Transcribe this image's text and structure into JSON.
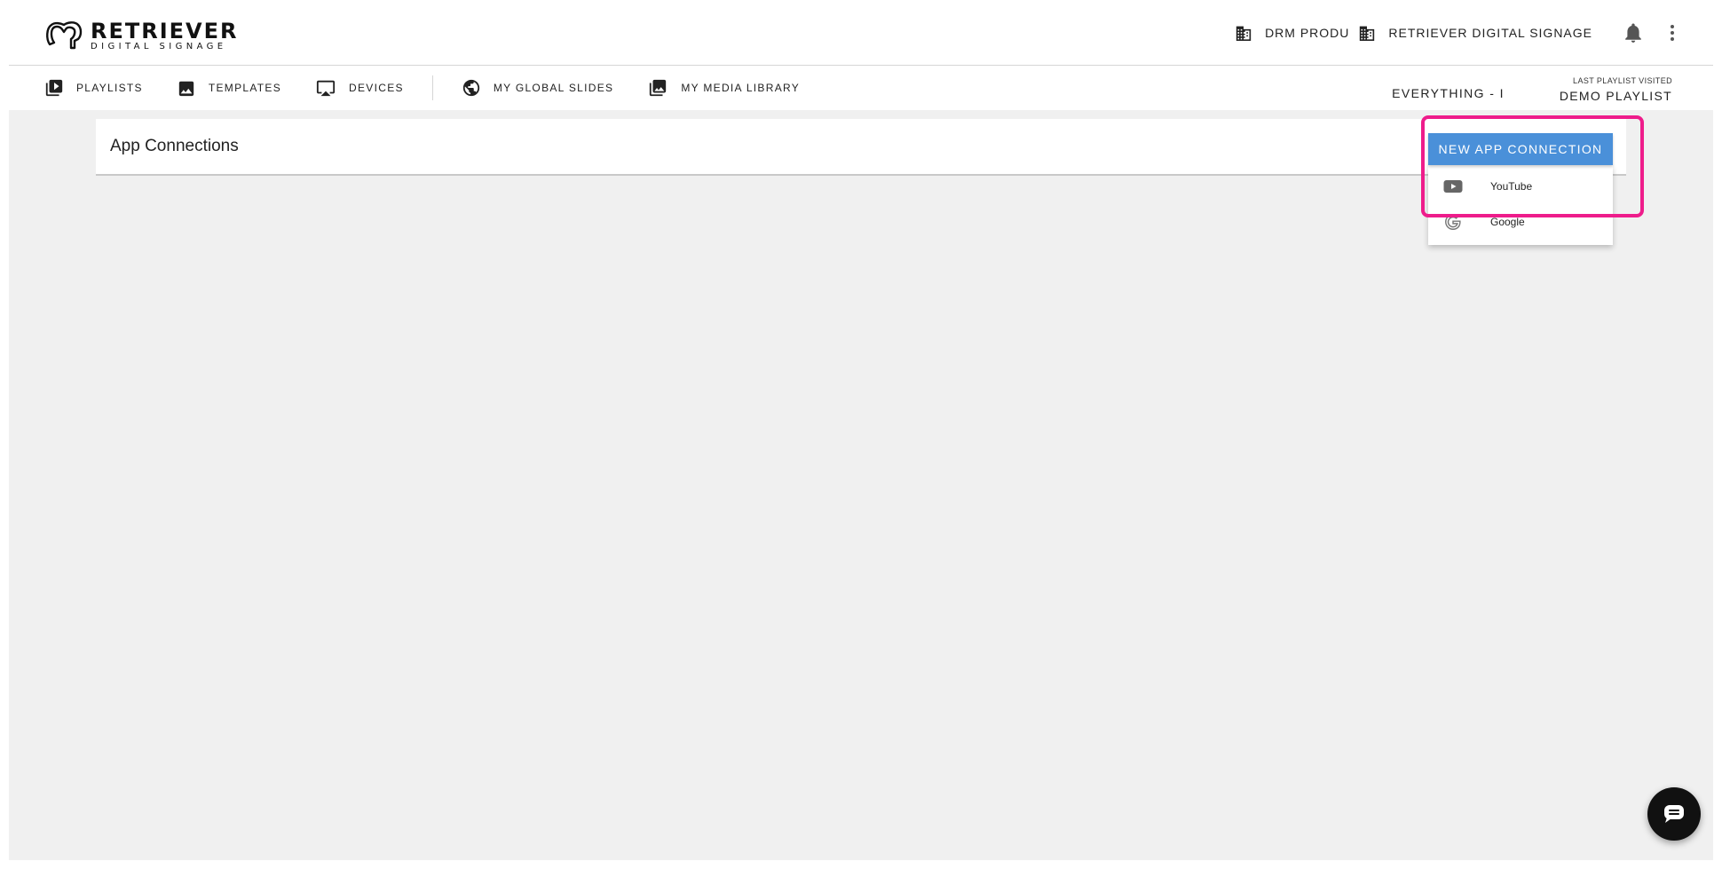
{
  "brand": {
    "title": "RETRIEVER",
    "subtitle": "DIGITAL SIGNAGE"
  },
  "header": {
    "org_short": "DRM PRODU",
    "org_name": "RETRIEVER DIGITAL SIGNAGE",
    "icons": [
      "building-icon",
      "bell-icon",
      "more-vert-icon"
    ]
  },
  "nav": {
    "items": [
      {
        "label": "PLAYLISTS",
        "icon": "playlist-play-icon"
      },
      {
        "label": "TEMPLATES",
        "icon": "image-icon"
      },
      {
        "label": "DEVICES",
        "icon": "airplay-icon"
      },
      {
        "label": "MY GLOBAL SLIDES",
        "icon": "globe-icon"
      },
      {
        "label": "MY MEDIA LIBRARY",
        "icon": "photo-library-icon"
      }
    ],
    "everything_label": "EVERYTHING - I",
    "last_visited_label": "LAST PLAYLIST VISITED",
    "last_visited_name": "DEMO PLAYLIST"
  },
  "page": {
    "title": "App Connections",
    "new_button_label": "NEW APP CONNECTION",
    "menu": [
      {
        "label": "YouTube",
        "icon": "youtube-icon"
      },
      {
        "label": "Google",
        "icon": "google-icon"
      }
    ]
  },
  "colors": {
    "accent": "#4a90d9",
    "highlight": "#ee1c8b",
    "background": "#f0f0f0"
  }
}
